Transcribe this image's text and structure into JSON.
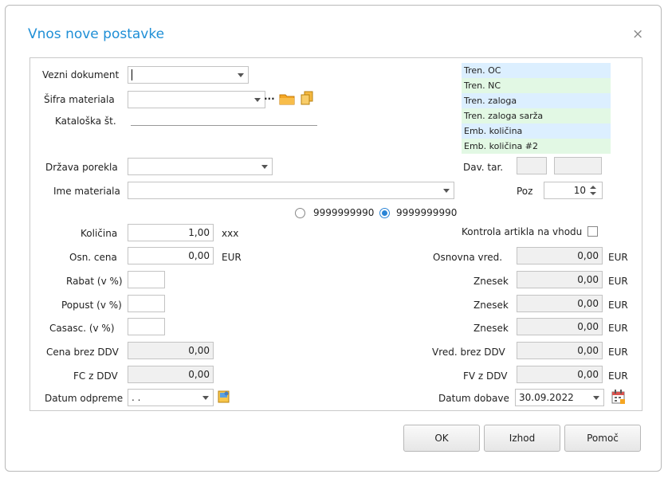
{
  "dialog": {
    "title": "Vnos nove postavke",
    "close_glyph": "×"
  },
  "left": {
    "vezni_dokument_label": "Vezni dokument",
    "vezni_dokument_value": "",
    "sifra_materiala_label": "Šifra materiala",
    "sifra_materiala_value": "",
    "ellipsis_label": "···",
    "kataloska_label": "Kataloška št.",
    "drzava_porekla_label": "Država porekla",
    "ime_materiala_label": "Ime materiala",
    "kolicina_label": "Količina",
    "kolicina_value": "1,00",
    "kolicina_unit": "xxx",
    "osn_cena_label": "Osn. cena",
    "osn_cena_value": "0,00",
    "osn_cena_unit": "EUR",
    "rabat_label": "Rabat (v %)",
    "popust_label": "Popust (v %)",
    "casasc_label": "Casasc. (v %)",
    "cena_brez_ddv_label": "Cena brez DDV",
    "cena_brez_ddv_value": "0,00",
    "fc_z_ddv_label": "FC z DDV",
    "fc_z_ddv_value": "0,00",
    "datum_odpreme_label": "Datum odpreme",
    "datum_odpreme_value": ". ."
  },
  "info_list": [
    "Tren. OC",
    "Tren. NC",
    "Tren. zaloga",
    "Tren. zaloga sarža",
    "Emb. količina",
    "Emb. količina #2"
  ],
  "right": {
    "dav_tar_label": "Dav. tar.",
    "poz_label": "Poz",
    "poz_value": "10",
    "radio_1_label": "9999999990",
    "radio_2_label": "9999999990",
    "kontrola_label": "Kontrola artikla na vhodu",
    "osnovna_vred_label": "Osnovna vred.",
    "osnovna_vred_value": "0,00",
    "znesek_label": "Znesek",
    "znesek_1_value": "0,00",
    "znesek_2_value": "0,00",
    "znesek_3_value": "0,00",
    "vred_brez_ddv_label": "Vred. brez DDV",
    "vred_brez_ddv_value": "0,00",
    "fv_z_ddv_label": "FV z DDV",
    "fv_z_ddv_value": "0,00",
    "datum_dobave_label": "Datum dobave",
    "datum_dobave_value": "30.09.2022",
    "currency": "EUR"
  },
  "buttons": {
    "ok": "OK",
    "izhod": "Izhod",
    "pomoc": "Pomoč"
  },
  "icons": [
    "combo-arrow-icon",
    "folder-icon",
    "copy-icon",
    "note-icon",
    "calendar-icon",
    "spinner-icon"
  ],
  "colors": {
    "title": "#1f8fd6",
    "list_blue": "#dcefff",
    "list_green": "#e2f8e4",
    "radio_accent": "#2a84d6"
  }
}
